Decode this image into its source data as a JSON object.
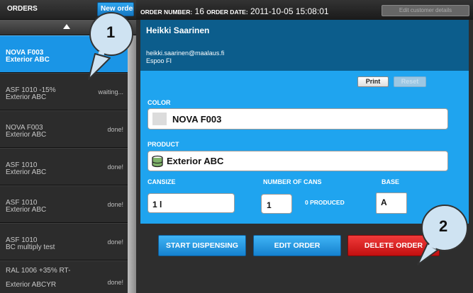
{
  "orders_pane": {
    "title": "ORDERS",
    "new_order_label": "New order",
    "items": [
      {
        "line1": "NOVA F003",
        "line2": "Exterior ABC",
        "status": "",
        "selected": true
      },
      {
        "line1": "ASF 1010 -15%",
        "line2": "Exterior ABC",
        "status": "waiting...",
        "selected": false
      },
      {
        "line1": "NOVA F003",
        "line2": "Exterior ABC",
        "status": "done!",
        "selected": false
      },
      {
        "line1": "ASF 1010",
        "line2": "Exterior ABC",
        "status": "done!",
        "selected": false
      },
      {
        "line1": "ASF 1010",
        "line2": "Exterior ABC",
        "status": "done!",
        "selected": false
      },
      {
        "line1": "ASF 1010",
        "line2": "BC multiply test",
        "status": "done!",
        "selected": false
      },
      {
        "line1": "RAL 1006 +35% RT-",
        "line2": "Exterior ABCYR",
        "status": "done!",
        "selected": false
      }
    ]
  },
  "header": {
    "order_number_label": "ORDER NUMBER:",
    "order_number": "16",
    "order_date_label": "ORDER DATE:",
    "order_date": "2011-10-05 15:08:01",
    "edit_customer_label": "Edit customer details"
  },
  "customer": {
    "name": "Heikki Saarinen",
    "email": "heikki.saarinen@maalaus.fi",
    "city": "Espoo  FI"
  },
  "order": {
    "print_label": "Print",
    "reset_label": "Reset",
    "color_label": "COLOR",
    "color_value": "NOVA F003",
    "color_swatch": "#dcdcdc",
    "product_label": "PRODUCT",
    "product_value": "Exterior ABC",
    "product_icon": "paint-can-icon",
    "cansize_label": "CANSIZE",
    "cansize_value": "1 l",
    "cans_label": "NUMBER OF CANS",
    "cans_value": "1",
    "produced_label": "0 PRODUCED",
    "base_label": "BASE",
    "base_value": "A"
  },
  "actions": {
    "start_label": "START DISPENSING",
    "edit_label": "EDIT ORDER",
    "delete_label": "DELETE ORDER"
  },
  "callouts": [
    "1",
    "2"
  ],
  "colors": {
    "accent_blue": "#1fa4ef",
    "customer_blue": "#0c5d8c",
    "delete_red": "#d41c1c",
    "callout_fill": "#cfe3f2"
  }
}
